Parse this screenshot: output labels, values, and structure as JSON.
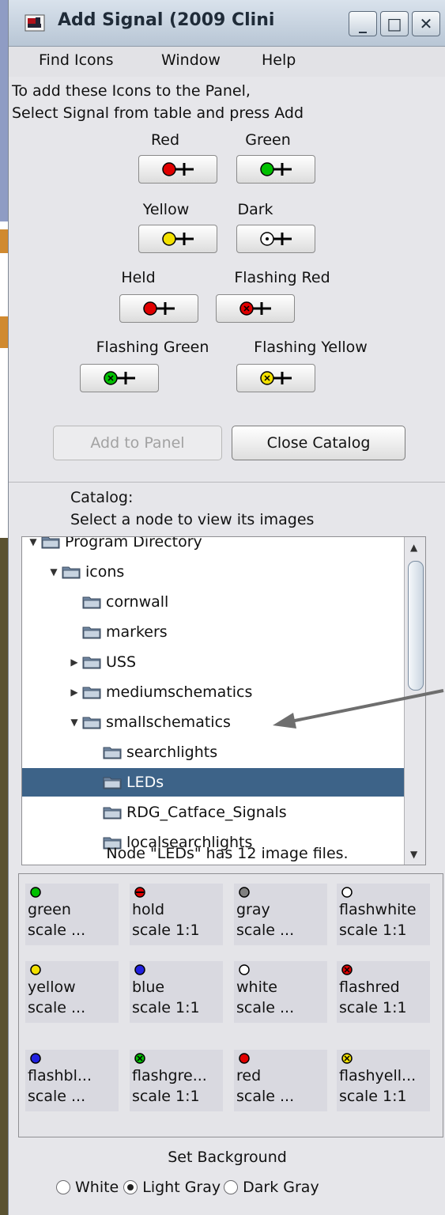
{
  "window": {
    "title": "Add Signal (2009 Clini",
    "minimize_glyph": "_",
    "maximize_glyph": "□",
    "close_glyph": "✕"
  },
  "menu": [
    "Find Icons",
    "Window",
    "Help"
  ],
  "instructions": {
    "line1": "To add these Icons to the Panel,",
    "line2": "Select Signal from table and press Add"
  },
  "signal_icons": [
    {
      "label": "Red",
      "color": "#e00000",
      "style": "solid"
    },
    {
      "label": "Green",
      "color": "#00c000",
      "style": "solid"
    },
    {
      "label": "Yellow",
      "color": "#f2e000",
      "style": "solid"
    },
    {
      "label": "Dark",
      "color": "#ffffff",
      "style": "dark"
    },
    {
      "label": "Held",
      "color": "#e00000",
      "style": "solid"
    },
    {
      "label": "Flashing Red",
      "color": "#e00000",
      "style": "flash"
    },
    {
      "label": "Flashing Green",
      "color": "#00c000",
      "style": "flash"
    },
    {
      "label": "Flashing Yellow",
      "color": "#f2e000",
      "style": "flash"
    }
  ],
  "buttons": {
    "add_to_panel": "Add to Panel",
    "close_catalog": "Close Catalog"
  },
  "catalog": {
    "label": "Catalog:",
    "hint": "Select a node to view its images",
    "tree": [
      {
        "label": "Program Directory",
        "expanded": true,
        "indent": 0
      },
      {
        "label": "icons",
        "expanded": true,
        "indent": 1
      },
      {
        "label": "cornwall",
        "expanded": null,
        "indent": 2
      },
      {
        "label": "markers",
        "expanded": null,
        "indent": 2
      },
      {
        "label": "USS",
        "expanded": false,
        "indent": 2
      },
      {
        "label": "mediumschematics",
        "expanded": false,
        "indent": 2
      },
      {
        "label": "smallschematics",
        "expanded": true,
        "indent": 2
      },
      {
        "label": "searchlights",
        "expanded": null,
        "indent": 3
      },
      {
        "label": "LEDs",
        "expanded": null,
        "indent": 3,
        "selected": true
      },
      {
        "label": "RDG_Catface_Signals",
        "expanded": null,
        "indent": 3
      },
      {
        "label": "localsearchlights",
        "expanded": null,
        "indent": 3
      }
    ]
  },
  "node_status": "Node \"LEDs\" has 12 image files.",
  "images": [
    {
      "name": "green",
      "scale": "scale ...",
      "color": "#00c000",
      "style": "solid"
    },
    {
      "name": "hold",
      "scale": "scale 1:1",
      "color": "#e00000",
      "style": "hold"
    },
    {
      "name": "gray",
      "scale": "scale ...",
      "color": "#808080",
      "style": "solid"
    },
    {
      "name": "flashwhite",
      "scale": "scale 1:1",
      "color": "#ffffff",
      "style": "solid"
    },
    {
      "name": "yellow",
      "scale": "scale ...",
      "color": "#f2e000",
      "style": "solid"
    },
    {
      "name": "blue",
      "scale": "scale 1:1",
      "color": "#2020e0",
      "style": "solid"
    },
    {
      "name": "white",
      "scale": "scale ...",
      "color": "#ffffff",
      "style": "solid"
    },
    {
      "name": "flashred",
      "scale": "scale 1:1",
      "color": "#e00000",
      "style": "flash"
    },
    {
      "name": "flashbl...",
      "scale": "scale ...",
      "color": "#2020e0",
      "style": "solid"
    },
    {
      "name": "flashgre...",
      "scale": "scale 1:1",
      "color": "#00c000",
      "style": "flash"
    },
    {
      "name": "red",
      "scale": "scale ...",
      "color": "#e00000",
      "style": "solid"
    },
    {
      "name": "flashyell...",
      "scale": "scale 1:1",
      "color": "#f2e000",
      "style": "flash"
    }
  ],
  "background": {
    "label": "Set Background",
    "options": [
      {
        "label": "White",
        "checked": false
      },
      {
        "label": "Light Gray",
        "checked": true
      },
      {
        "label": "Dark Gray",
        "checked": false
      }
    ]
  },
  "colors": {
    "selection": "#3d6388",
    "title_gradient_top": "#d9e2ec",
    "title_gradient_bottom": "#b8c6d5"
  }
}
